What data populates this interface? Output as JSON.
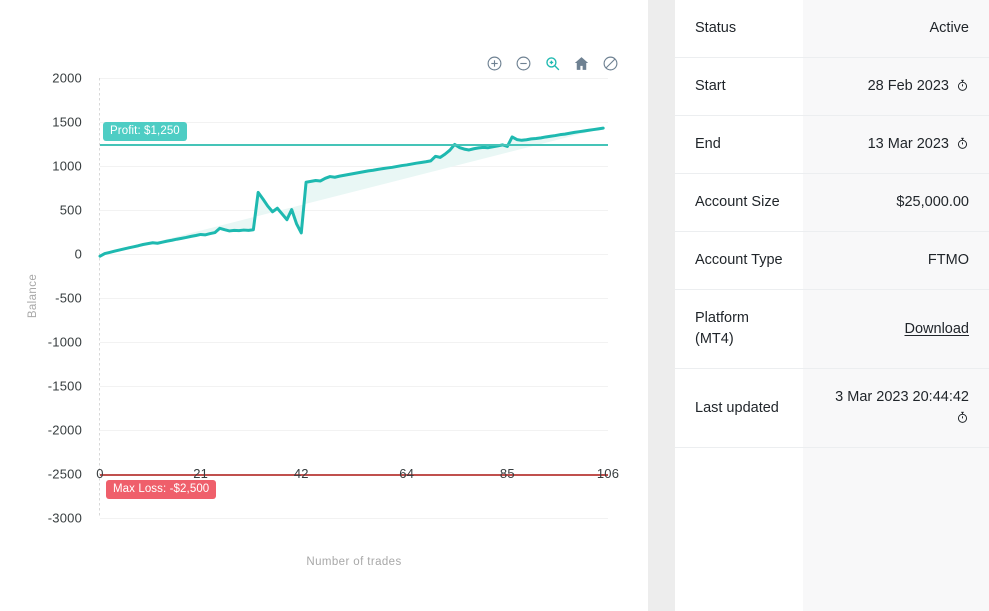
{
  "chart": {
    "toolbar": [
      {
        "name": "zoom-in-icon",
        "label": "Zoom In",
        "active": false
      },
      {
        "name": "zoom-out-icon",
        "label": "Zoom Out",
        "active": false
      },
      {
        "name": "selection-zoom-icon",
        "label": "Selection Zoom",
        "active": true
      },
      {
        "name": "reset-home-icon",
        "label": "Reset Zoom",
        "active": false
      },
      {
        "name": "pan-disabled-icon",
        "label": "Panning Disabled",
        "active": false
      }
    ],
    "profit_badge": "Profit: $1,250",
    "loss_badge": "Max Loss: -$2,500",
    "colors": {
      "line": "#1eb9b0",
      "area_fill": "#e9f7f5",
      "profit_line": "#45c4b8",
      "profit_badge_bg": "#4ecdc4",
      "loss_line": "#c0504d",
      "loss_badge_bg": "#ef5f6b",
      "grid": "#f2f2f2",
      "axis_text": "#373d3f",
      "axis_title": "#a8a8a8"
    }
  },
  "chart_data": {
    "type": "area",
    "title": "",
    "subtitle": "",
    "xlabel": "Number of trades",
    "ylabel": "Balance",
    "xlim": [
      0,
      106
    ],
    "ylim": [
      -3000,
      2000
    ],
    "xticks": [
      0,
      21,
      42,
      64,
      85,
      106
    ],
    "yticks": [
      2000,
      1500,
      1000,
      500,
      0,
      -500,
      -1000,
      -1500,
      -2000,
      -2500,
      -3000
    ],
    "grid": true,
    "legend": "none",
    "annotations": [
      {
        "name": "profit-target",
        "label": "Profit: $1,250",
        "y": 1250,
        "color": "#45c4b8"
      },
      {
        "name": "max-loss",
        "label": "Max Loss: -$2,500",
        "y": -2500,
        "color": "#c0504d"
      }
    ],
    "series": [
      {
        "name": "Balance",
        "color": "#1eb9b0",
        "x": [
          0,
          1,
          2,
          3,
          4,
          5,
          6,
          7,
          8,
          9,
          10,
          11,
          12,
          13,
          14,
          15,
          16,
          17,
          18,
          19,
          20,
          21,
          22,
          23,
          24,
          25,
          26,
          27,
          28,
          29,
          30,
          31,
          32,
          33,
          34,
          35,
          36,
          37,
          38,
          39,
          40,
          41,
          42,
          43,
          44,
          45,
          46,
          47,
          48,
          49,
          50,
          51,
          52,
          53,
          54,
          55,
          56,
          57,
          58,
          59,
          60,
          61,
          62,
          63,
          64,
          65,
          66,
          67,
          68,
          69,
          70,
          71,
          72,
          73,
          74,
          75,
          76,
          77,
          78,
          79,
          80,
          81,
          82,
          83,
          84,
          85,
          86,
          87,
          88,
          89,
          90,
          91,
          92,
          93,
          94,
          95,
          96,
          97,
          98,
          99,
          100,
          101,
          102,
          103,
          104,
          105,
          106
        ],
        "values": [
          -25,
          5,
          18,
          32,
          45,
          58,
          70,
          82,
          94,
          108,
          118,
          128,
          122,
          134,
          146,
          156,
          168,
          178,
          188,
          200,
          210,
          222,
          218,
          232,
          244,
          292,
          276,
          262,
          268,
          266,
          272,
          268,
          276,
          700,
          625,
          545,
          480,
          520,
          455,
          390,
          505,
          345,
          240,
          815,
          825,
          835,
          830,
          860,
          880,
          872,
          885,
          895,
          905,
          915,
          925,
          935,
          945,
          952,
          962,
          970,
          978,
          985,
          995,
          1005,
          1012,
          1022,
          1032,
          1040,
          1048,
          1058,
          1110,
          1098,
          1135,
          1180,
          1245,
          1210,
          1192,
          1182,
          1196,
          1206,
          1212,
          1208,
          1218,
          1228,
          1240,
          1222,
          1330,
          1300,
          1292,
          1298,
          1308,
          1312,
          1320,
          1330,
          1338,
          1346,
          1356,
          1362,
          1372,
          1382,
          1390,
          1398,
          1406,
          1414,
          1422,
          1430
        ]
      }
    ]
  },
  "info": {
    "rows": [
      {
        "key": "Status",
        "value": "Active",
        "icon": null,
        "link": false
      },
      {
        "key": "Start",
        "value": "28 Feb 2023",
        "icon": "stopwatch-icon",
        "link": false
      },
      {
        "key": "End",
        "value": "13 Mar 2023",
        "icon": "stopwatch-icon",
        "link": false
      },
      {
        "key": "Account Size",
        "value": "$25,000.00",
        "icon": null,
        "link": false
      },
      {
        "key": "Account Type",
        "value": "FTMO",
        "icon": null,
        "link": false
      },
      {
        "key": "Platform (MT4)",
        "value": "Download",
        "icon": null,
        "link": true
      },
      {
        "key": "Last updated",
        "value": "3 Mar 2023 20:44:42",
        "icon": "stopwatch-icon",
        "link": false
      }
    ]
  }
}
